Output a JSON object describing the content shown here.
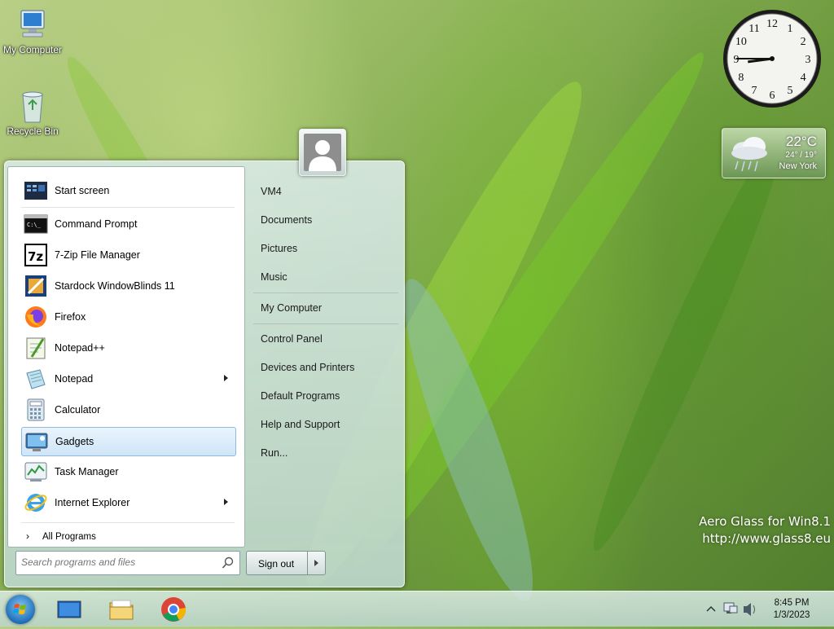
{
  "desktop": {
    "icons": [
      {
        "label": "My Computer",
        "icon": "computer-icon"
      },
      {
        "label": "Recycle Bin",
        "icon": "recycle-bin-icon"
      }
    ],
    "watermark": {
      "line1": "Aero Glass for Win8.1",
      "line2": "http://www.glass8.eu"
    }
  },
  "gadgets": {
    "clock": {
      "hour": 8,
      "minute": 45,
      "numbers": [
        "12",
        "1",
        "2",
        "3",
        "4",
        "5",
        "6",
        "7",
        "8",
        "9",
        "10",
        "11"
      ]
    },
    "weather": {
      "temp": "22°C",
      "range": "24° / 19°",
      "city": "New York",
      "icon": "rain-cloud-icon"
    }
  },
  "start_menu": {
    "user_avatar": "user-avatar-icon",
    "programs": [
      {
        "label": "Start screen",
        "icon": "start-screen-icon",
        "submenu": false
      },
      {
        "label": "Command Prompt",
        "icon": "command-prompt-icon",
        "submenu": false
      },
      {
        "label": "7-Zip File Manager",
        "icon": "7zip-icon",
        "submenu": false
      },
      {
        "label": "Stardock WindowBlinds 11",
        "icon": "windowblinds-icon",
        "submenu": false
      },
      {
        "label": "Firefox",
        "icon": "firefox-icon",
        "submenu": false
      },
      {
        "label": "Notepad++",
        "icon": "notepadpp-icon",
        "submenu": false
      },
      {
        "label": "Notepad",
        "icon": "notepad-icon",
        "submenu": true
      },
      {
        "label": "Calculator",
        "icon": "calculator-icon",
        "submenu": false
      },
      {
        "label": "Gadgets",
        "icon": "gadgets-icon",
        "submenu": false,
        "selected": true
      },
      {
        "label": "Task Manager",
        "icon": "task-manager-icon",
        "submenu": false
      },
      {
        "label": "Internet Explorer",
        "icon": "internet-explorer-icon",
        "submenu": true
      }
    ],
    "all_programs": "All Programs",
    "search_placeholder": "Search programs and files",
    "right_items": [
      {
        "label": "VM4"
      },
      {
        "label": "Documents"
      },
      {
        "label": "Pictures"
      },
      {
        "label": "Music"
      },
      {
        "label": "My Computer"
      },
      {
        "label": "Control Panel"
      },
      {
        "label": "Devices and Printers"
      },
      {
        "label": "Default Programs"
      },
      {
        "label": "Help and Support"
      },
      {
        "label": "Run..."
      }
    ],
    "sign_out": "Sign out"
  },
  "taskbar": {
    "pinned": [
      {
        "icon": "desktop-icon"
      },
      {
        "icon": "file-explorer-icon"
      },
      {
        "icon": "chrome-icon"
      }
    ],
    "tray_icons": [
      "chevron-up-icon",
      "network-icon",
      "volume-icon"
    ],
    "time": "8:45 PM",
    "date": "1/3/2023"
  }
}
